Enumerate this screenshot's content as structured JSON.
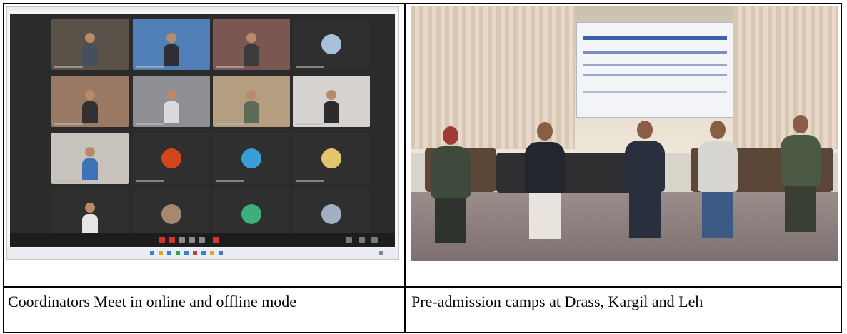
{
  "captions": {
    "left": "Coordinators Meet in online and offline mode",
    "right": "Pre-admission camps at Drass, Kargil and Leh"
  },
  "images": {
    "left": "video-conference-screenshot",
    "right": "group-photo-seated-on-stage"
  },
  "colors": {
    "border": "#000000",
    "zoom_background": "#2b2b2b",
    "zoom_red_button": "#d9342b"
  }
}
